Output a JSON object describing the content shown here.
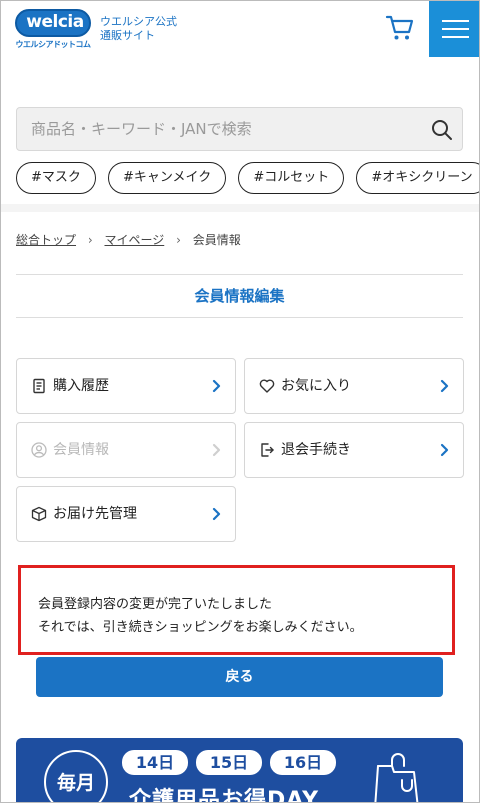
{
  "header": {
    "logo_text": "welcia",
    "logo_sub": "ウエルシアドットコム",
    "site_name_line1": "ウエルシア公式",
    "site_name_line2": "通販サイト",
    "cart_icon": "cart-icon",
    "menu_icon": "hamburger-menu-icon"
  },
  "search": {
    "placeholder": "商品名・キーワード・JANで検索",
    "icon": "search-icon"
  },
  "tags": [
    "#マスク",
    "#キャンメイク",
    "#コルセット",
    "#オキシクリーン",
    "#"
  ],
  "breadcrumb": {
    "items": [
      "総合トップ",
      "マイページ"
    ],
    "current": "会員情報"
  },
  "page_title": "会員情報編集",
  "menu": {
    "purchase_history": "購入履歴",
    "favorites": "お気に入り",
    "member_info": "会員情報",
    "withdraw": "退会手続き",
    "delivery": "お届け先管理"
  },
  "message": {
    "line1": "会員登録内容の変更が完了いたしました",
    "line2": "それでは、引き続きショッピングをお楽しみください。"
  },
  "back_button": "戻る",
  "banner": {
    "badge": "毎月",
    "days": [
      "14日",
      "15日",
      "16日"
    ],
    "text": "介護用品お得DAY"
  },
  "colors": {
    "brand_blue": "#1b73c4",
    "menu_blue": "#1b8fd8",
    "alert_red": "#e0201f",
    "banner_navy": "#1e4ea0"
  }
}
